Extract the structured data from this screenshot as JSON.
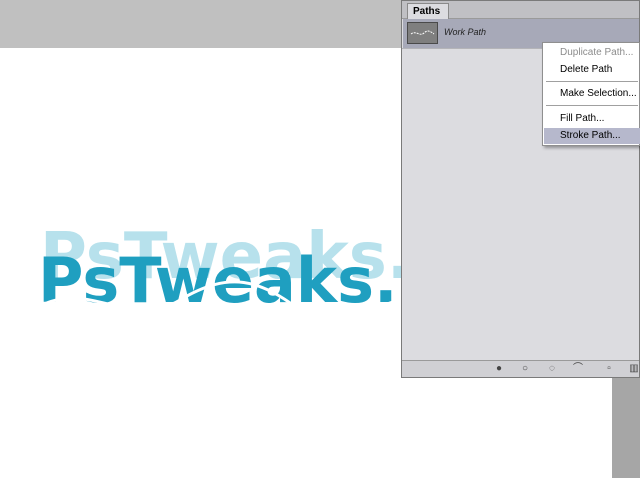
{
  "canvas": {
    "artwork_text": "PsTweaks.",
    "text_color": "#1f9fc0",
    "reflection_color": "#9fd8e6"
  },
  "paths_panel": {
    "tab_label": "Paths",
    "path_name": "Work Path",
    "footer_icons": [
      "fill-path-icon",
      "stroke-path-icon",
      "load-as-selection-icon",
      "make-work-path-icon",
      "new-path-icon",
      "delete-path-icon"
    ]
  },
  "context_menu": {
    "items": [
      {
        "label": "Duplicate Path...",
        "disabled": true
      },
      {
        "label": "Delete Path",
        "disabled": false
      },
      {
        "label": "Make Selection...",
        "disabled": false
      },
      {
        "label": "Fill Path...",
        "disabled": false
      },
      {
        "label": "Stroke Path...",
        "disabled": false,
        "highlighted": true
      }
    ]
  }
}
